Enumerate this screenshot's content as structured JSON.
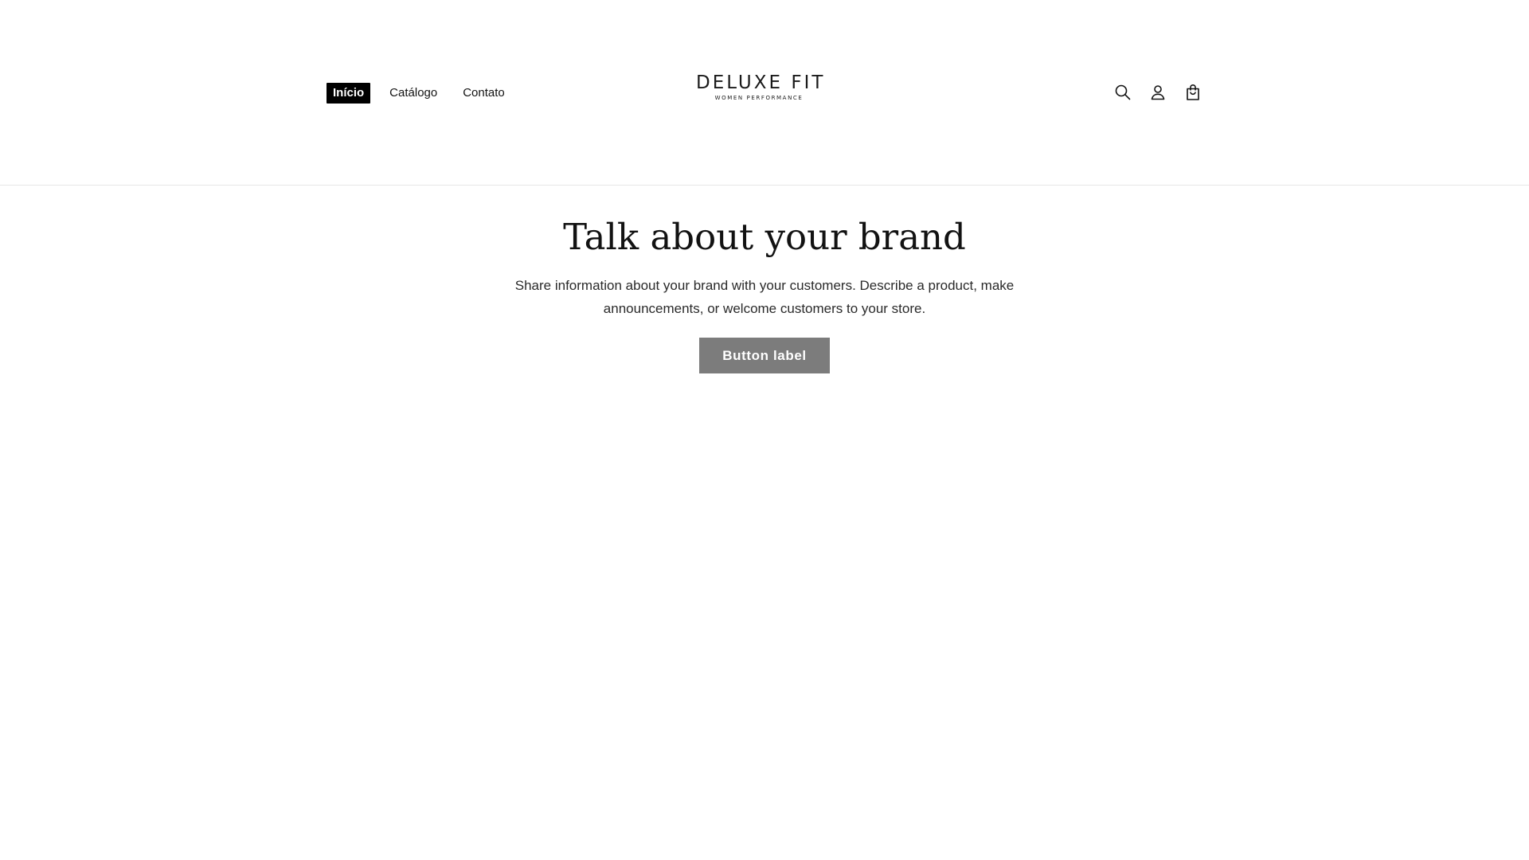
{
  "header": {
    "nav": [
      {
        "label": "Início",
        "active": true
      },
      {
        "label": "Catálogo",
        "active": false
      },
      {
        "label": "Contato",
        "active": false
      }
    ],
    "logo": {
      "main": "DELUXE FIT",
      "sub": "WOMEN PERFORMANCE"
    },
    "icons": [
      "search-icon",
      "account-icon",
      "cart-icon"
    ]
  },
  "hero": {
    "title": "Talk about your brand",
    "text": "Share information about your brand with your customers. Describe a product, make announcements, or welcome customers to your store.",
    "button_label": "Button label"
  },
  "colors": {
    "active_nav_bg": "#000000",
    "button_bg": "#7c7c7c",
    "divider": "#e6e6e6"
  }
}
